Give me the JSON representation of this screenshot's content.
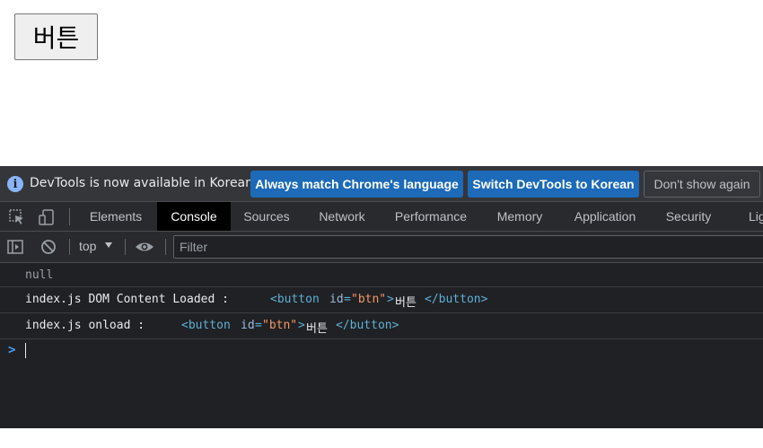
{
  "page": {
    "button_label": "버튼"
  },
  "devtools": {
    "infobar": {
      "message": "DevTools is now available in Korean!",
      "match_language_label": "Always match Chrome's language",
      "switch_language_label": "Switch DevTools to Korean",
      "dismiss_label": "Don't show again"
    },
    "tabs": [
      {
        "label": "Elements",
        "active": false
      },
      {
        "label": "Console",
        "active": true
      },
      {
        "label": "Sources",
        "active": false
      },
      {
        "label": "Network",
        "active": false
      },
      {
        "label": "Performance",
        "active": false
      },
      {
        "label": "Memory",
        "active": false
      },
      {
        "label": "Application",
        "active": false
      },
      {
        "label": "Security",
        "active": false
      },
      {
        "label": "Lig",
        "active": false
      }
    ],
    "toolbar": {
      "context": "top",
      "filter_placeholder": "Filter"
    },
    "console": {
      "messages": [
        {
          "text": "null"
        },
        {
          "label": "index.js DOM Content Loaded :",
          "element": {
            "open_tag": "<button",
            "attr_name": "id",
            "eq": "=",
            "attr_value": "\"btn\"",
            "close_open": ">",
            "content": "버튼",
            "close_tag": "</button>"
          }
        },
        {
          "label": "index.js onload :",
          "element": {
            "open_tag": "<button",
            "attr_name": "id",
            "eq": "=",
            "attr_value": "\"btn\"",
            "close_open": ">",
            "content": "버튼",
            "close_tag": "</button>"
          }
        }
      ],
      "prompt": ">"
    }
  },
  "colors": {
    "accent": "#1c6ab8",
    "devtools_bg": "#202124",
    "tag": "#5db0d7",
    "attr_value": "#f29766"
  }
}
